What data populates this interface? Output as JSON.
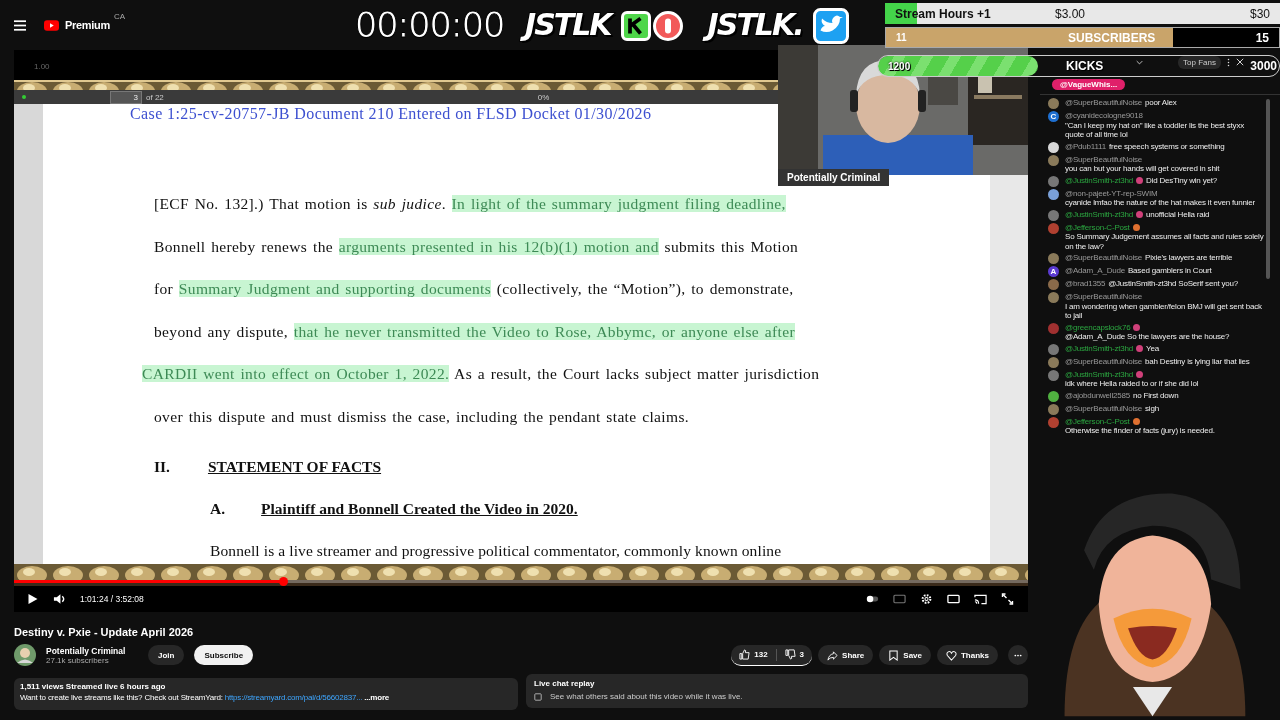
{
  "top_bar": {
    "logo": "Premium",
    "region": "CA"
  },
  "overlay": {
    "timer": "00:00:00",
    "logos": [
      {
        "kind": "kick",
        "text": "JSTLK"
      },
      {
        "kind": "twitter",
        "text": "JSTLK."
      }
    ]
  },
  "goals": [
    {
      "kind": "hours",
      "label": "Stream Hours +1",
      "current": "$3.00",
      "target": "$30",
      "level": 0.08
    },
    {
      "kind": "subs",
      "current": "11",
      "label": "SUBSCRIBERS",
      "target": "15",
      "level": 0.73
    },
    {
      "kind": "kicks",
      "current": "1200",
      "label": "KICKS",
      "target": "3000",
      "level": 0.4
    }
  ],
  "pdf": {
    "zoom": "1.00",
    "page": "3",
    "page_count": "of 22",
    "progress": "0%"
  },
  "document": {
    "header": "Case 1:25-cv-20757-JB   Document 210   Entered on FLSD Docket 01/30/2026",
    "lines": [
      [
        {
          "text": "[ECF No. 132].) That motion is *sub judice*. ",
          "highlighted": false
        },
        {
          "text": "In light of the summary judgment filing deadline,",
          "highlighted": true
        }
      ],
      [
        {
          "text": "Bonnell hereby renews the ",
          "highlighted": false
        },
        {
          "text": "arguments presented in his 12(b)(1) motion and",
          "highlighted": true
        },
        {
          "text": " submits this Motion",
          "highlighted": false
        }
      ],
      [
        {
          "text": "for ",
          "highlighted": false
        },
        {
          "text": "Summary Judgment and supporting documents",
          "highlighted": true
        },
        {
          "text": " (collectively, the “Motion”), to demonstrate,",
          "highlighted": false
        }
      ],
      [
        {
          "text": "beyond any dispute, ",
          "highlighted": false
        },
        {
          "text": "that he never transmitted the Video to Rose, Abbymc, or anyone else after",
          "highlighted": true
        }
      ],
      [
        {
          "text": "CARDII went into effect on October 1, 2022.",
          "highlighted": true
        },
        {
          "text": " As a result, the Court lacks subject matter jurisdiction",
          "highlighted": false
        }
      ],
      [
        {
          "text": "over this dispute and must dismiss the case, including the pendant state claims.",
          "highlighted": false
        }
      ]
    ],
    "section": {
      "number": "II.",
      "title": "STATEMENT OF FACTS"
    },
    "subsection": {
      "number": "A.",
      "title": "Plaintiff and Bonnell Created the Video in 2020."
    },
    "last_line": "Bonnell is a live streamer and progressive political commentator, commonly known online"
  },
  "webcam": {
    "caption": "Potentially Criminal"
  },
  "player": {
    "playing": false,
    "time": "1:01:24 / 3:52:08",
    "level": 0.265
  },
  "video": {
    "title": "Destiny v. Pxie - Update April 2026",
    "channel": "Potentially Criminal",
    "subscribers": "27.1k subscribers",
    "join": "Join",
    "subscribe": "Subscribe",
    "likes": "132",
    "dislikes": "3",
    "actions": [
      {
        "kind": "share",
        "label": "Share"
      },
      {
        "kind": "save",
        "label": "Save"
      },
      {
        "kind": "thanks",
        "label": "Thanks"
      }
    ]
  },
  "description": {
    "stats": "1,511 views  Streamed live 6 hours ago",
    "text": "Want to create live streams like this? Check out StreamYard:",
    "link": "https://streamyard.com/pal/d/56602837...",
    "more": "...more"
  },
  "chat_replay": {
    "title": "Live chat replay",
    "text": "See what others said about this video while it was live."
  },
  "chat": {
    "pinned": "@VagueWhis...",
    "filter": "Top Fans",
    "messages": [
      {
        "author": "@SuperBeautifulNoise",
        "text": "poor Alex",
        "member": false,
        "color": "#8a7a5a"
      },
      {
        "author": "@cyanidecologne9018",
        "text": "\"Can I keep my hat on\" like a toddler lis the best styxx quote of all time lol",
        "member": false,
        "color": "#1e6fd0",
        "letter": "C"
      },
      {
        "author": "@Pdub1111",
        "text": "free speech systems or something",
        "member": false,
        "color": "#d8d8d8"
      },
      {
        "author": "@SuperBeautifulNoise",
        "text": "you can but your hands will get covered in shit",
        "member": false,
        "color": "#8a7a5a"
      },
      {
        "author": "@JustinSmith-zt3hd",
        "text": "Did DesTiny win yet?",
        "member": true,
        "color": "#777777",
        "badge": {
          "color": "#d0407a"
        }
      },
      {
        "author": "@non-pajeet-YT-rep-SWIM",
        "text": "cyanide lmfao the nature of the hat makes it even funnier",
        "member": false,
        "color": "#7aa0d8"
      },
      {
        "author": "@JustinSmith-zt3hd",
        "text": "unofficial Hella raid",
        "member": true,
        "color": "#777777",
        "badge": {
          "color": "#d0407a"
        }
      },
      {
        "author": "@Jefferson-C-Post",
        "text": "So Summary Judgement assumes all facts and rules solely on the law?",
        "member": true,
        "color": "#b04030",
        "badge": {
          "color": "#e07030"
        }
      },
      {
        "author": "@SuperBeautifulNoise",
        "text": "Pixie's lawyers are terrible",
        "member": false,
        "color": "#8a7a5a"
      },
      {
        "author": "@Adam_A_Dude",
        "text": "Based gamblers in Court",
        "member": false,
        "color": "#5a3ad0",
        "letter": "A"
      },
      {
        "author": "@brad1355",
        "text": "@JustinSmith-zt3hd SoSerif sent you?",
        "member": false,
        "color": "#8a6a4a"
      },
      {
        "author": "@SuperBeautifulNoise",
        "text": "I am wondering when gambler/felon BMJ will get sent back to jail",
        "member": false,
        "color": "#8a7a5a"
      },
      {
        "author": "@greencapslock76",
        "text": "@Adam_A_Dude So the lawyers are the house?",
        "member": true,
        "color": "#a03030",
        "badge": {
          "color": "#d0407a"
        }
      },
      {
        "author": "@JustinSmith-zt3hd",
        "text": "Yea",
        "member": true,
        "color": "#777777",
        "badge": {
          "color": "#d0407a"
        }
      },
      {
        "author": "@SuperBeautifulNoise",
        "text": "bah Destiny is lying liar that lies",
        "member": false,
        "color": "#8a7a5a"
      },
      {
        "author": "@JustinSmith-zt3hd",
        "text": "idk where Hella raided to or if she did lol",
        "member": true,
        "color": "#777777",
        "badge": {
          "color": "#d0407a"
        }
      },
      {
        "author": "@ajobdunwell2585",
        "text": "no First down",
        "member": false,
        "color": "#50b040"
      },
      {
        "author": "@SuperBeautifulNoise",
        "text": "sigh",
        "member": false,
        "color": "#8a7a5a"
      },
      {
        "author": "@Jefferson-C-Post",
        "text": "Otherwise the finder of facts (jury) is needed.",
        "member": true,
        "color": "#b04030",
        "badge": {
          "color": "#e07030"
        }
      }
    ]
  }
}
